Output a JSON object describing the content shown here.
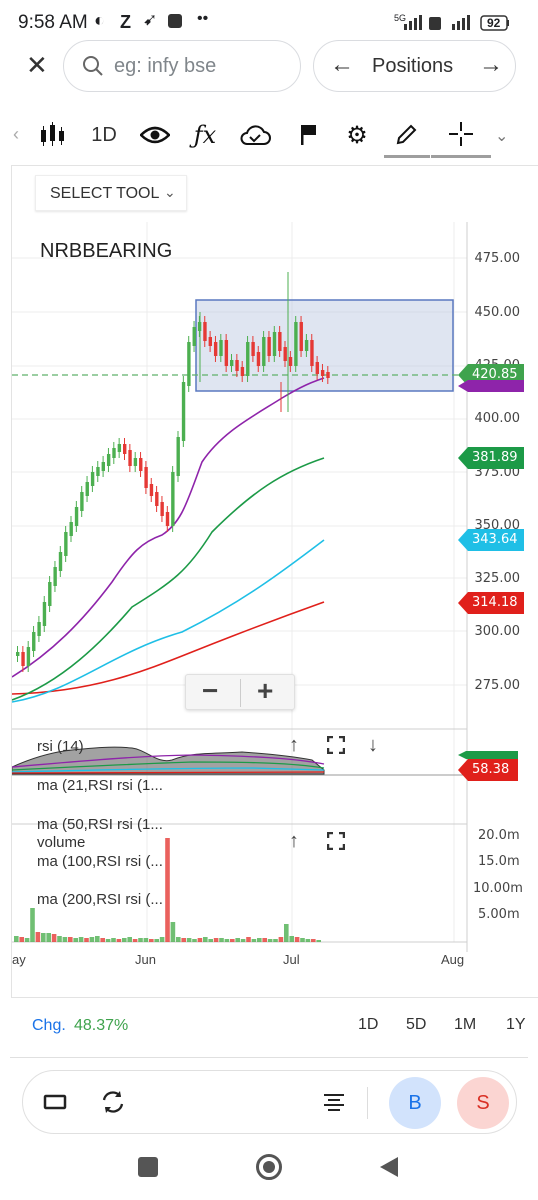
{
  "status_bar": {
    "time": "9:58 AM",
    "carrier_icons": [
      "Z"
    ],
    "network": "5G",
    "battery": "92"
  },
  "search": {
    "placeholder": "eg: infy bse",
    "positions_label": "Positions"
  },
  "toolbar": {
    "interval_label": "1D",
    "select_tool_label": "SELECT TOOL"
  },
  "chart": {
    "symbol": "NRBBEARING",
    "price_ticks": [
      "475.00",
      "450.00",
      "425.00",
      "400.00",
      "375.00",
      "350.00",
      "325.00",
      "300.00",
      "275.00"
    ],
    "price_tags": [
      {
        "label": "420.85",
        "color": "#3fa34d"
      },
      {
        "label": "381.89",
        "color": "#1c9a47"
      },
      {
        "label": "343.64",
        "color": "#1fbfe6"
      },
      {
        "label": "314.18",
        "color": "#e0201b"
      }
    ],
    "rsi_tag": {
      "label": "58.38",
      "color": "#e0201b"
    },
    "volume_ticks": [
      "20.0m",
      "15.0m",
      "10.00m",
      "5.00m"
    ],
    "x_labels": [
      "ay",
      "Jun",
      "Jul",
      "Aug"
    ],
    "zoom_out_label": "−",
    "zoom_in_label": "+"
  },
  "indicators": {
    "rsi": "rsi (14)",
    "ma21": "ma (21,RSI rsi (1...",
    "ma50": "ma (50,RSI rsi (1...",
    "volume": "volume",
    "ma100": "ma (100,RSI rsi (...",
    "ma200": "ma (200,RSI rsi (..."
  },
  "footer": {
    "chg_label": "Chg.",
    "chg_value": "48.37%",
    "ranges": [
      "1D",
      "5D",
      "1M",
      "1Y"
    ]
  },
  "actions": {
    "buy_label": "B",
    "sell_label": "S"
  },
  "colors": {
    "accent": "#1a73e8",
    "buy_bg": "#d2e3fc",
    "sell_bg": "#fbd5d2",
    "sell_text": "#d93025",
    "buy_text": "#1a73e8",
    "up_candle": "#4caf50",
    "down_candle": "#e53935",
    "ma21": "#8e24aa",
    "ma50": "#1c9a47",
    "ma100": "#1fbfe6",
    "ma200": "#e0201b"
  }
}
